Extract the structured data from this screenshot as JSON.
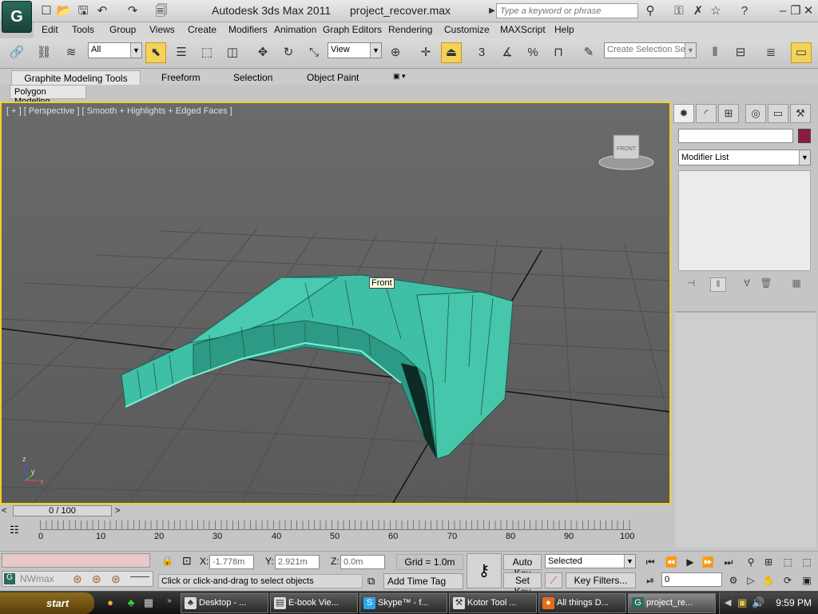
{
  "title_bar": {
    "app_name": "Autodesk 3ds Max  2011",
    "file_name": "project_recover.max",
    "search_placeholder": "Type a keyword or phrase"
  },
  "menu": {
    "items": [
      "Edit",
      "Tools",
      "Group",
      "Views",
      "Create",
      "Modifiers",
      "Animation",
      "Graph Editors",
      "Rendering",
      "Customize",
      "MAXScript",
      "Help"
    ]
  },
  "toolbar": {
    "filter_value": "All",
    "reference_value": "View",
    "snap_label": "3",
    "selection_set_placeholder": "Create Selection Se"
  },
  "ribbon": {
    "tabs": [
      "Graphite Modeling Tools",
      "Freeform",
      "Selection",
      "Object Paint"
    ],
    "sub_tab": "Polygon Modeling"
  },
  "viewport": {
    "label": "[ + ] [ Perspective ] [ Smooth + Highlights + Edged Faces ]",
    "tooltip": "Front",
    "viewcube_label": "FRONT",
    "axis_z": "z",
    "axis_y": "y",
    "axis_x": "x"
  },
  "command_panel": {
    "modifier_list": "Modifier List",
    "swatch_color": "#8b1a45"
  },
  "timeline": {
    "slider_label": "0 / 100",
    "ticks": [
      "0",
      "10",
      "20",
      "30",
      "40",
      "50",
      "60",
      "70",
      "80",
      "90",
      "100"
    ]
  },
  "status": {
    "script_label": "NWmax",
    "x_label": "X:",
    "x_value": "-1.778m",
    "y_label": "Y:",
    "y_value": "2.921m",
    "z_label": "Z:",
    "z_value": "0.0m",
    "grid": "Grid = 1.0m",
    "prompt": "Click or click-and-drag to select objects",
    "add_time_tag": "Add Time Tag",
    "auto_key": "Auto Key",
    "set_key": "Set Key",
    "key_mode": "Selected",
    "key_filters": "Key Filters...",
    "frame": "0"
  },
  "taskbar": {
    "start": "start",
    "tasks": [
      "Desktop - ...",
      "E-book Vie...",
      "Skype™ - f...",
      "Kotor Tool ...",
      "All things D...",
      "project_re..."
    ],
    "clock": "9:59 PM"
  }
}
